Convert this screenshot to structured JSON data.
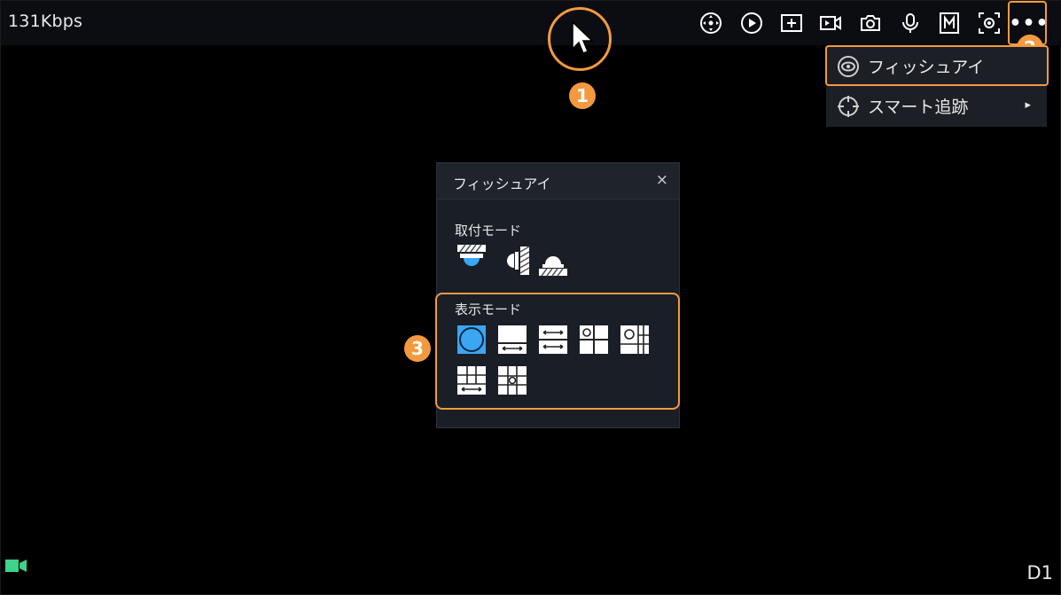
{
  "status": {
    "bitrate": "131Kbps",
    "channel": "D1"
  },
  "toolbar": {
    "icons": [
      "ptz-icon",
      "playback-icon",
      "zoom-in-icon",
      "record-icon",
      "snapshot-icon",
      "talk-icon",
      "manual-record-icon",
      "image-icon",
      "more-icon"
    ],
    "more_label": "•••"
  },
  "dropdown": {
    "items": [
      {
        "label": "フィッシュアイ",
        "icon": "fisheye-icon"
      },
      {
        "label": "スマート追跡",
        "icon": "target-icon",
        "arrow": "▸"
      }
    ]
  },
  "fisheye_panel": {
    "title": "フィッシュアイ",
    "close_label": "×",
    "mount_mode_label": "取付モード",
    "mount_modes": [
      "ceiling-mount-icon",
      "wall-mount-icon",
      "table-mount-icon"
    ],
    "display_mode_label": "表示モード",
    "display_modes": [
      "fisheye-view-icon",
      "panorama-view-icon",
      "dual-panorama-icon",
      "quad-view-icon",
      "six-view-icon",
      "grid-panorama-icon",
      "fisheye-grid-icon"
    ],
    "selected_display_mode": 0
  },
  "annotations": [
    "1",
    "2",
    "3"
  ],
  "colors": {
    "accent": "#f39a3f",
    "selected_blue": "#3ba6f2",
    "record_green": "#3ed28a"
  }
}
